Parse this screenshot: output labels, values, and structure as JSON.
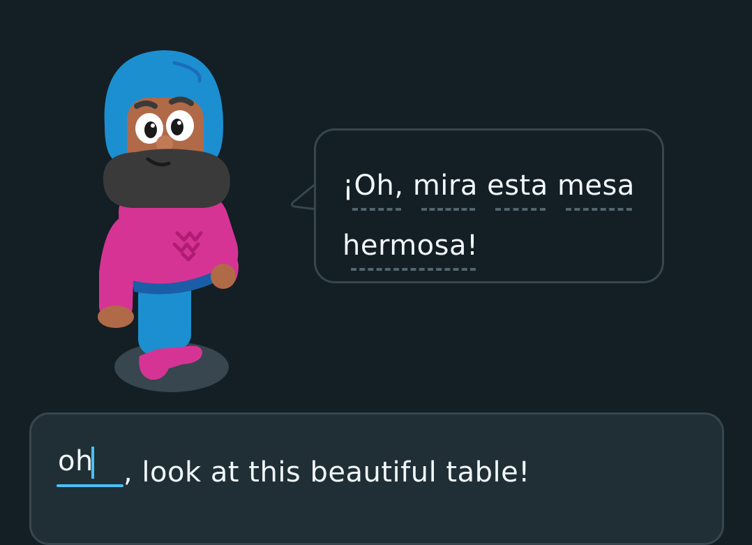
{
  "speech_bubble": {
    "words": [
      "¡Oh,",
      "mira",
      "esta",
      "mesa",
      "hermosa!"
    ]
  },
  "answer": {
    "typed_value": "oh",
    "rest_of_sentence": ", look at this beautiful table!"
  },
  "colors": {
    "background": "#131f24",
    "panel": "#202f36",
    "border": "#37464f",
    "accent": "#49c0f8",
    "text": "#f1f7fb"
  },
  "icons": {
    "character": "character-illustration"
  }
}
